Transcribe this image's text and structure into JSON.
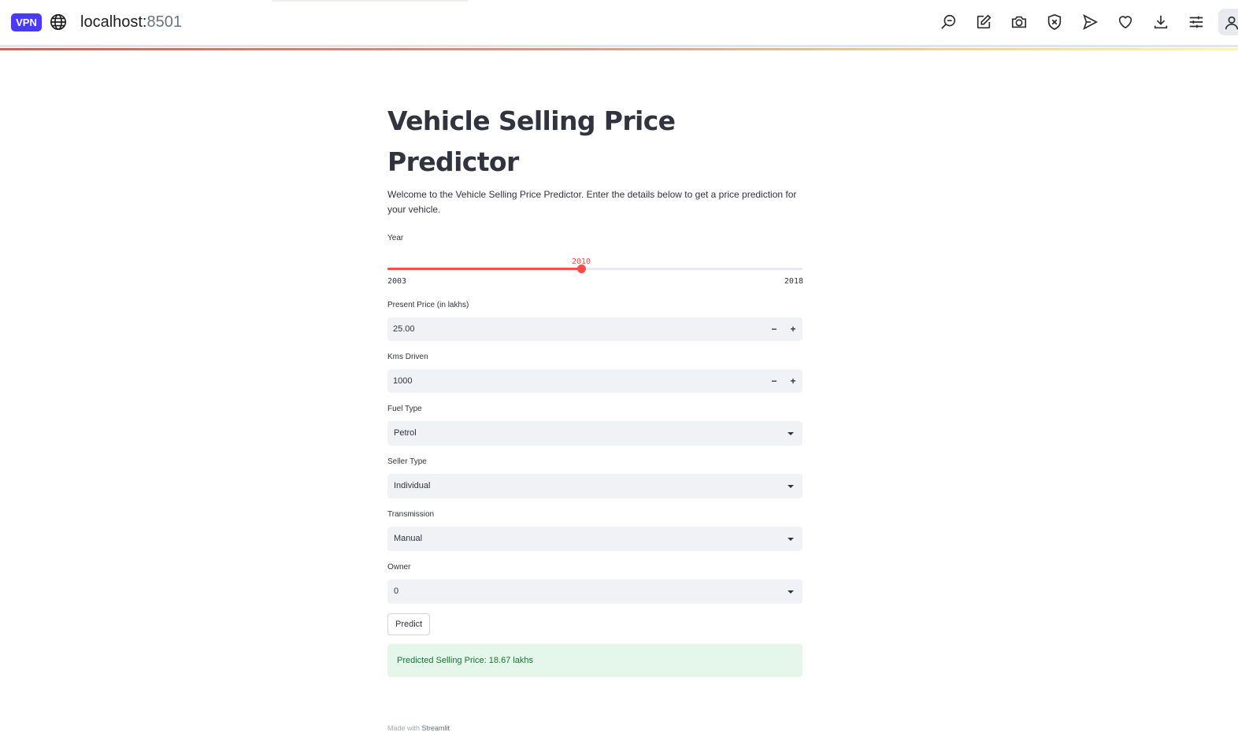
{
  "browser": {
    "vpn_badge": "VPN",
    "url_host": "localhost:",
    "url_port": "8501",
    "toolbar_icons": [
      "search-icon",
      "edit-icon",
      "camera-icon",
      "shield-x-icon",
      "send-icon",
      "heart-icon",
      "download-icon",
      "sliders-icon",
      "profile-icon"
    ]
  },
  "app": {
    "title": "Vehicle Selling Price Predictor",
    "intro": "Welcome to the Vehicle Selling Price Predictor. Enter the details below to get a price prediction for your vehicle.",
    "year": {
      "label": "Year",
      "value": "2010",
      "min": "2003",
      "max": "2018",
      "fraction": 0.467
    },
    "present_price": {
      "label": "Present Price (in lakhs)",
      "value": "25.00",
      "minus": "−",
      "plus": "+"
    },
    "kms_driven": {
      "label": "Kms Driven",
      "value": "1000",
      "minus": "−",
      "plus": "+"
    },
    "fuel_type": {
      "label": "Fuel Type",
      "value": "Petrol"
    },
    "seller_type": {
      "label": "Seller Type",
      "value": "Individual"
    },
    "transmission": {
      "label": "Transmission",
      "value": "Manual"
    },
    "owner": {
      "label": "Owner",
      "value": "0"
    },
    "predict_button": "Predict",
    "result": "Predicted Selling Price: 18.67 lakhs",
    "accent_color": "#ff4b4b",
    "success_color": "#177233"
  },
  "footer": {
    "made_with": "Made with ",
    "brand": "Streamlit"
  }
}
